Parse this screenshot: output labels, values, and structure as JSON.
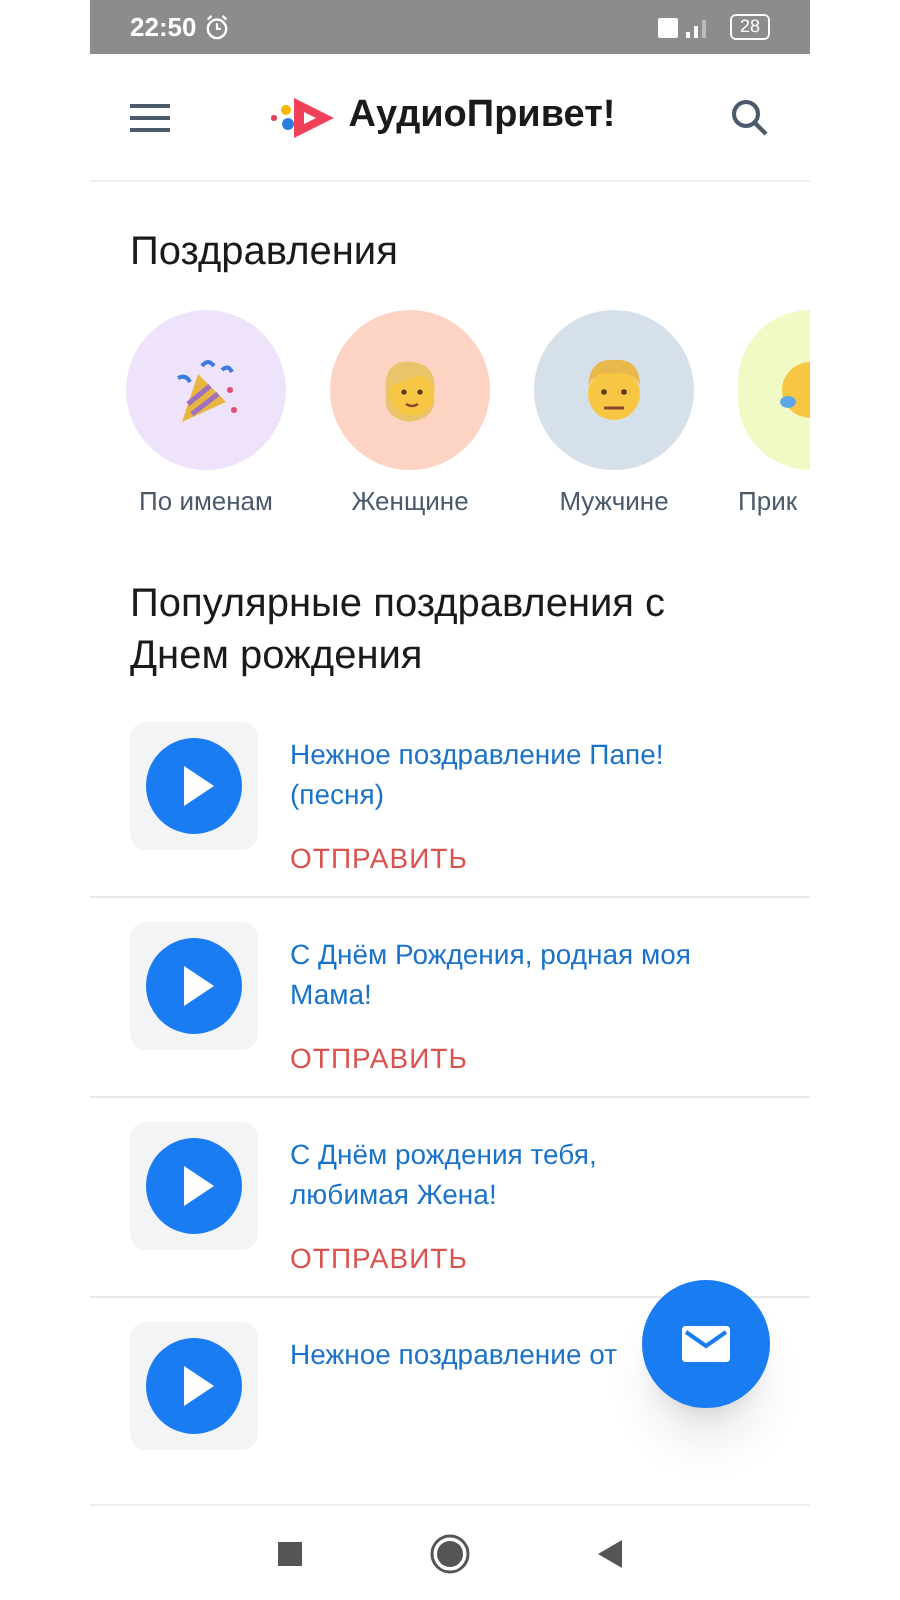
{
  "status_bar": {
    "time": "22:50",
    "battery": "28"
  },
  "header": {
    "logo_text": "АудиоПривет!"
  },
  "categories": {
    "title": "Поздравления",
    "items": [
      {
        "kind": "party",
        "label": "По именам",
        "color": "#efe3fb"
      },
      {
        "kind": "woman",
        "label": "Женщине",
        "color": "#fdd3c3"
      },
      {
        "kind": "man",
        "label": "Мужчине",
        "color": "#d6e0ea"
      },
      {
        "kind": "crying",
        "label": "Прик",
        "color": "#f1f9c4"
      }
    ]
  },
  "popular": {
    "title": "Популярные поздравления с Днем рождения",
    "items": [
      {
        "title": "Нежное поздравление Папе! (песня)",
        "action": "ОТПРАВИТЬ"
      },
      {
        "title": "С Днём Рождения, родная моя Мама!",
        "action": "ОТПРАВИТЬ"
      },
      {
        "title": "С Днём рождения тебя, любимая Жена!",
        "action": "ОТПРАВИТЬ"
      },
      {
        "title": "Нежное поздравление от"
      }
    ]
  }
}
